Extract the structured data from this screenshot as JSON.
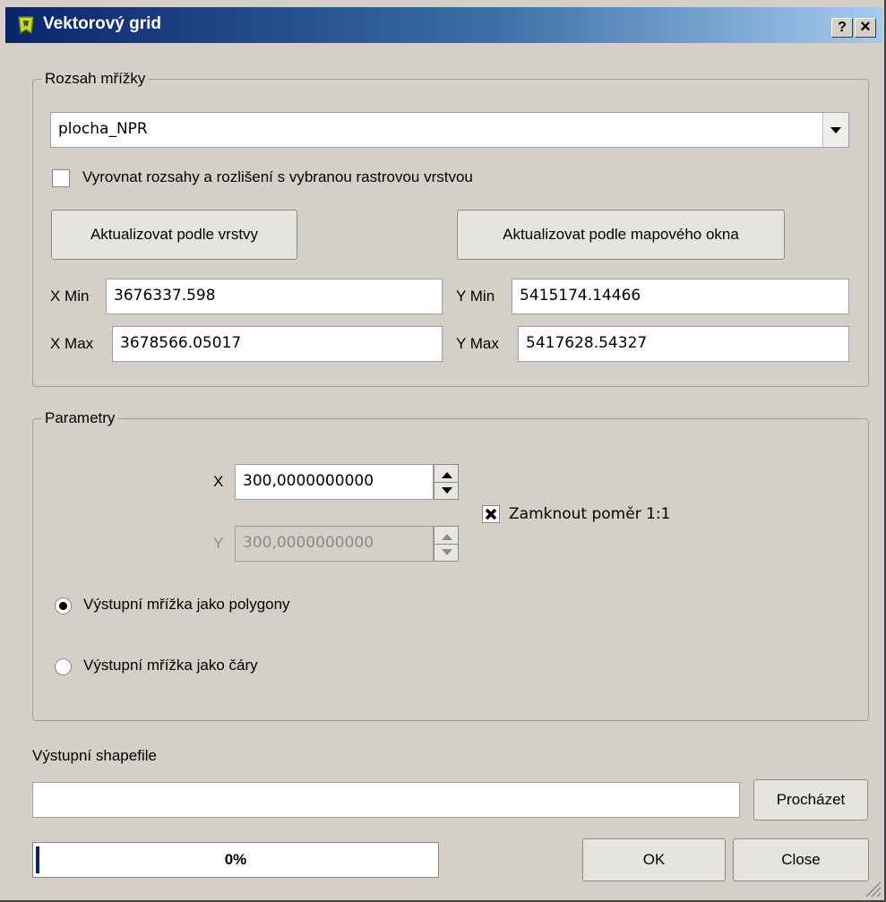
{
  "window": {
    "title": "Vektorový grid",
    "help_label": "?",
    "close_label": "×"
  },
  "extent_group": {
    "title": "Rozsah mřížky",
    "layer_select": {
      "selected": "plocha_NPR"
    },
    "align_checkbox": {
      "label": "Vyrovnat rozsahy a rozlišení s vybranou rastrovou vrstvou",
      "checked": false
    },
    "update_from_layer_label": "Aktualizovat podle vrstvy",
    "update_from_canvas_label": "Aktualizovat podle mapového okna",
    "xmin": {
      "label": "X Min",
      "value": "3676337.598"
    },
    "ymin": {
      "label": "Y Min",
      "value": "5415174.14466"
    },
    "xmax": {
      "label": "X Max",
      "value": "3678566.05017"
    },
    "ymax": {
      "label": "Y Max",
      "value": "5417628.54327"
    }
  },
  "params_group": {
    "title": "Parametry",
    "x": {
      "label": "X",
      "value": "300,0000000000"
    },
    "y": {
      "label": "Y",
      "value": "300,0000000000",
      "enabled": false
    },
    "lock_ratio": {
      "label": "Zamknout poměr 1:1",
      "checked": true
    },
    "output_polygons": {
      "label": "Výstupní mřížka jako polygony",
      "selected": true
    },
    "output_lines": {
      "label": "Výstupní mřížka jako čáry",
      "selected": false
    }
  },
  "output": {
    "label": "Výstupní shapefile",
    "path_value": "",
    "browse_label": "Procházet"
  },
  "progress": {
    "value": 0,
    "text": "0%"
  },
  "buttons": {
    "ok_label": "OK",
    "close_label": "Close"
  },
  "colors": {
    "titlebar_start": "#0a246a",
    "titlebar_end": "#a6caf0",
    "dialog_bg": "#d4d0c8"
  }
}
